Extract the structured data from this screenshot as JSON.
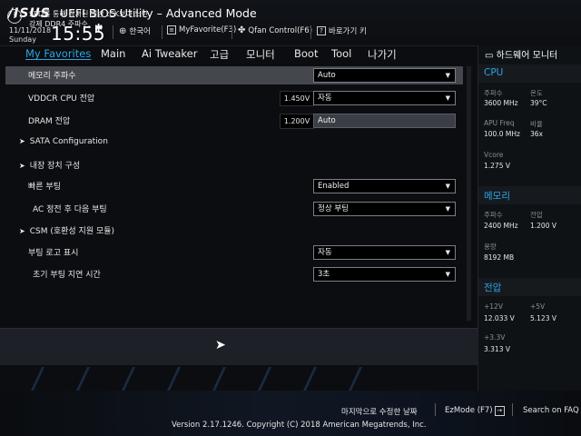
{
  "header": {
    "brand": "/ISUS",
    "title": "UEFI BIOS Utility – Advanced Mode",
    "date": "11/11/2018",
    "day": "Sunday",
    "time": "15:55",
    "items": [
      {
        "icon": "globe-icon",
        "label": "한국어"
      },
      {
        "icon": "favorite-icon",
        "label": "MyFavorite(F3)"
      },
      {
        "icon": "fan-icon",
        "label": "Qfan Control(F6)"
      },
      {
        "icon": "hotkey-icon",
        "label": "바로가기 키"
      }
    ]
  },
  "menu": {
    "tabs": [
      "My Favorites",
      "Main",
      "Ai Tweaker",
      "고급",
      "모니터",
      "Boot",
      "Tool",
      "나가기"
    ],
    "active": "My Favorites"
  },
  "settings": [
    {
      "label": "메모리 주파수",
      "value": "Auto",
      "type": "dropdown"
    },
    {
      "label": "VDDCR CPU 전압",
      "volt": "1.450V",
      "value": "자동",
      "type": "dropdown"
    },
    {
      "label": "DRAM 전압",
      "volt": "1.200V",
      "value": "Auto",
      "type": "text"
    },
    {
      "label": "SATA Configuration",
      "type": "group"
    },
    {
      "label": "내장 장치 구성",
      "type": "group"
    },
    {
      "label": "빠른 부팅",
      "value": "Enabled",
      "type": "dropdown"
    },
    {
      "label": "AC 정전 후 다음 부팅",
      "value": "정상 부팅",
      "type": "dropdown"
    },
    {
      "label": "CSM (호환성 지원 모듈)",
      "type": "group"
    },
    {
      "label": "부팅 로고 표시",
      "value": "자동",
      "type": "dropdown"
    },
    {
      "label": "초기 부팅 지연 시간",
      "value": "3초",
      "type": "dropdown"
    }
  ],
  "help": {
    "line1": "SPD를 통해 감지된 일반 tCK보다 느린",
    "line2": "강제 DDR4 주파수."
  },
  "monitor": {
    "title": "하드웨어 모니터",
    "cpu": {
      "heading": "CPU",
      "freq_label": "주파수",
      "freq_value": "3600 MHz",
      "temp_label": "온도",
      "temp_value": "39°C",
      "apu_label": "APU Freq",
      "apu_value": "100.0 MHz",
      "ratio_label": "비율",
      "ratio_value": "36x",
      "vcore_label": "Vcore",
      "vcore_value": "1.275 V"
    },
    "memory": {
      "heading": "메모리",
      "freq_label": "주파수",
      "freq_value": "2400 MHz",
      "volt_label": "전압",
      "volt_value": "1.200 V",
      "cap_label": "용량",
      "cap_value": "8192 MB"
    },
    "voltage": {
      "heading": "전압",
      "v12_label": "+12V",
      "v12_value": "12.033 V",
      "v5_label": "+5V",
      "v5_value": "5.123 V",
      "v33_label": "+3.3V",
      "v33_value": "3.313 V"
    }
  },
  "footer": {
    "last_modified": "마지막으로 수정한 날짜",
    "ezmode": "EzMode (F7)",
    "search": "Search on FAQ",
    "version": "Version 2.17.1246. Copyright (C) 2018 American Megatrends, Inc."
  },
  "colors": {
    "accent": "#2ba6e6",
    "highlight_row": "#44474d",
    "background": "#0b0d10"
  }
}
